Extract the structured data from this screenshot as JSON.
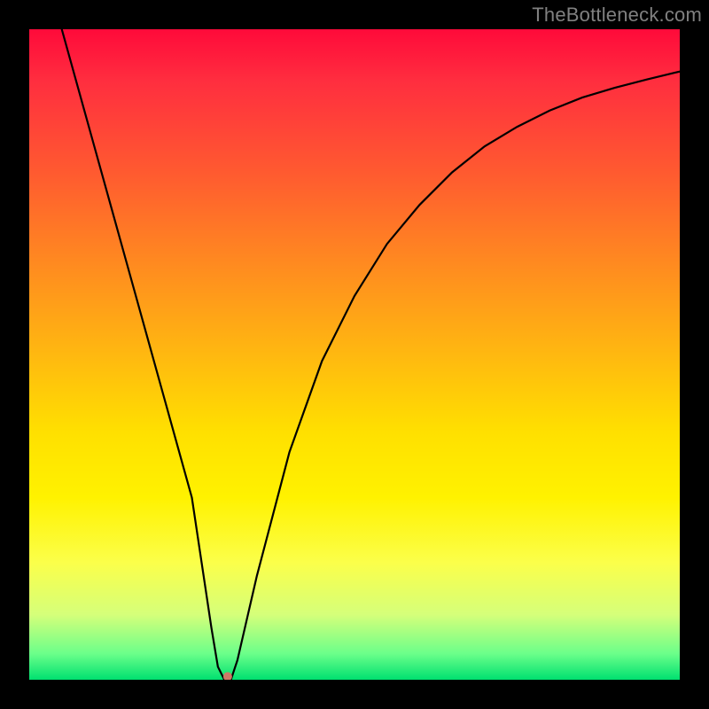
{
  "watermark": "TheBottleneck.com",
  "chart_data": {
    "type": "line",
    "title": "",
    "xlabel": "",
    "ylabel": "",
    "xlim": [
      0,
      100
    ],
    "ylim": [
      0,
      100
    ],
    "grid": false,
    "legend": false,
    "x": [
      5,
      10,
      15,
      20,
      25,
      28,
      29,
      30,
      31,
      32,
      35,
      40,
      45,
      50,
      55,
      60,
      65,
      70,
      75,
      80,
      85,
      90,
      95,
      100
    ],
    "values": [
      100,
      82,
      64,
      46,
      28,
      8,
      2,
      0,
      0,
      3,
      16,
      35,
      49,
      59,
      67,
      73,
      78,
      82,
      85,
      87.5,
      89.5,
      91,
      92.3,
      93.5
    ],
    "marker": {
      "x": 30.5,
      "y": 0.5,
      "color": "#cc7a66",
      "radius_px": 5
    }
  }
}
